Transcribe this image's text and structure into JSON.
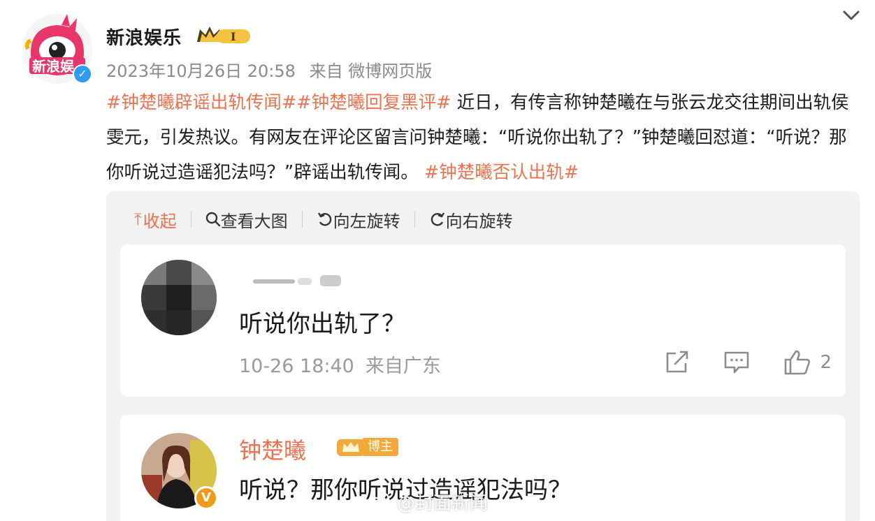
{
  "post": {
    "username": "新浪娱乐",
    "vip_level": "I",
    "date": "2023年10月26日 20:58",
    "source": "来自 微博网页版",
    "text": {
      "hashtag1": "#钟楚曦辟谣出轨传闻#",
      "hashtag2": "#钟楚曦回复黑评#",
      "body": " 近日，有传言称钟楚曦在与张云龙交往期间出轨侯雯元，引发热议。有网友在评论区留言问钟楚曦：“听说你出轨了？”钟楚曦回怼道：“听说？那你听说过造谣犯法吗？”辟谣出轨传闻。 ",
      "hashtag3": "#钟楚曦否认出轨#"
    }
  },
  "image_toolbar": {
    "collapse": "收起",
    "view_large": "查看大图",
    "rotate_left": "向左旋转",
    "rotate_right": "向右旋转"
  },
  "comments": [
    {
      "text": "听说你出轨了？",
      "date": "10-26 18:40",
      "location": "来自广东",
      "likes": "2"
    },
    {
      "author": "钟楚曦",
      "badge": "博主",
      "text": "听说？那你听说过造谣犯法吗？"
    }
  ],
  "watermark": "@封面新闻",
  "colors": {
    "hashtag": "#eb7350",
    "verified_blue": "#2e9bf0",
    "verified_gold": "#f19a1a"
  }
}
